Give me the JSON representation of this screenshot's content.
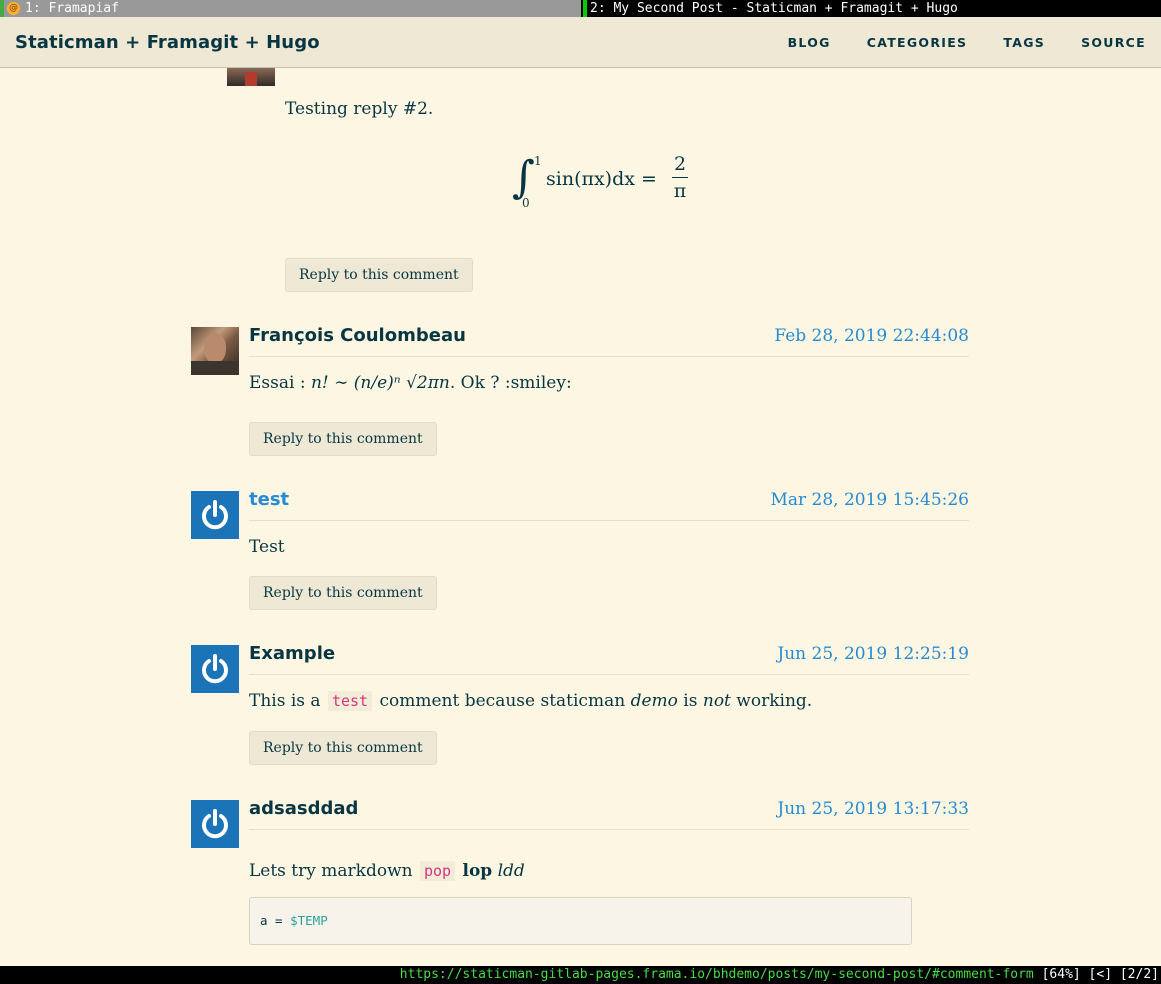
{
  "tabs": [
    {
      "label": "1: Framapiaf"
    },
    {
      "label": "2: My Second Post - Staticman + Framagit + Hugo"
    }
  ],
  "header": {
    "title": "Staticman + Framagit + Hugo",
    "nav": [
      "BLOG",
      "CATEGORIES",
      "TAGS",
      "SOURCE"
    ]
  },
  "comments": [
    {
      "body": "Testing reply #2.",
      "math": {
        "upper": "1",
        "lower": "0",
        "expr": "sin(πx)dx =",
        "num": "2",
        "den": "π"
      },
      "reply": "Reply to this comment"
    },
    {
      "author": "François Coulombeau",
      "date": "Feb 28, 2019 22:44:08",
      "body_prefix": "Essai : ",
      "math_inline": "n! ∼ (n/e)ⁿ √2πn",
      "body_suffix": ". Ok ? :smiley:",
      "reply": "Reply to this comment"
    },
    {
      "author": "test",
      "date": "Mar 28, 2019 15:45:26",
      "body": "Test",
      "reply": "Reply to this comment"
    },
    {
      "author": "Example",
      "date": "Jun 25, 2019 12:25:19",
      "body_a": "This is a",
      "code": "test",
      "body_b": "comment because staticman",
      "em1": "demo",
      "body_c": "is",
      "em2": "not",
      "body_d": "working.",
      "reply": "Reply to this comment"
    },
    {
      "author": "adsasddad",
      "date": "Jun 25, 2019 13:17:33",
      "body_a": "Lets try markdown",
      "code": "pop",
      "strong": "lop",
      "em": "ldd",
      "codeblock_prefix": "a = ",
      "codeblock_var": "$TEMP"
    }
  ],
  "statusbar": {
    "url": "https://staticman-gitlab-pages.frama.io/bhdemo/posts/my-second-post/#comment-form",
    "meta": "[64%] [<] [2/2]"
  }
}
